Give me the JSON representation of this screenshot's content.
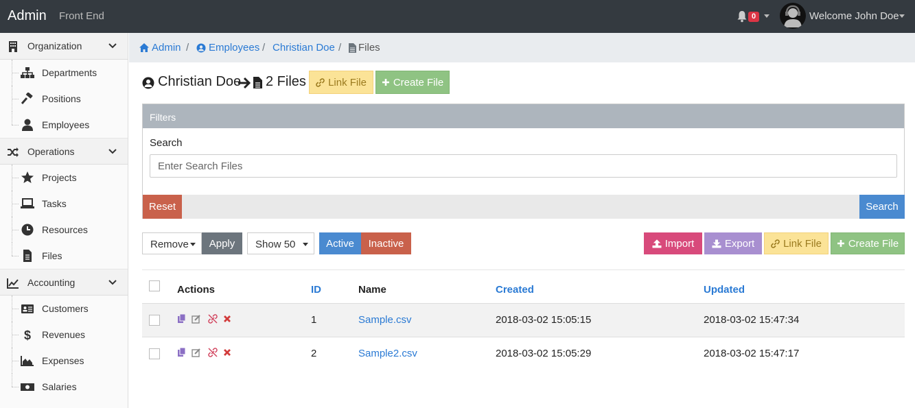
{
  "topbar": {
    "brand": "Admin",
    "front_end": "Front End",
    "notification_count": "0",
    "welcome": "Welcome John Doe"
  },
  "sidebar": {
    "sections": [
      {
        "label": "Organization",
        "icon": "building-icon",
        "items": [
          {
            "label": "Departments",
            "icon": "sitemap-icon"
          },
          {
            "label": "Positions",
            "icon": "gavel-icon"
          },
          {
            "label": "Employees",
            "icon": "user-icon"
          }
        ]
      },
      {
        "label": "Operations",
        "icon": "random-icon",
        "items": [
          {
            "label": "Projects",
            "icon": "star-icon"
          },
          {
            "label": "Tasks",
            "icon": "laptop-icon"
          },
          {
            "label": "Resources",
            "icon": "clock-icon"
          },
          {
            "label": "Files",
            "icon": "file-icon"
          }
        ]
      },
      {
        "label": "Accounting",
        "icon": "line-chart-icon",
        "items": [
          {
            "label": "Customers",
            "icon": "address-card-icon"
          },
          {
            "label": "Revenues",
            "icon": "dollar-icon"
          },
          {
            "label": "Expenses",
            "icon": "area-chart-icon"
          },
          {
            "label": "Salaries",
            "icon": "money-icon"
          }
        ]
      }
    ]
  },
  "breadcrumb": {
    "admin": "Admin",
    "employees": "Employees",
    "person": "Christian Doe",
    "current": "Files",
    "separator": "/"
  },
  "heading": {
    "person": "Christian Doe",
    "files": "2 Files",
    "link_file": "Link File",
    "create_file": "Create File"
  },
  "filters": {
    "title": "Filters",
    "search_label": "Search",
    "search_placeholder": "Enter Search Files",
    "search_value": "",
    "reset": "Reset",
    "search_button": "Search"
  },
  "toolbar": {
    "bulk_action": "Remove",
    "apply": "Apply",
    "show": "Show 50",
    "active": "Active",
    "inactive": "Inactive",
    "import": "Import",
    "export": "Export",
    "link_file": "Link File",
    "create_file": "Create File"
  },
  "table": {
    "columns": {
      "actions": "Actions",
      "id": "ID",
      "name": "Name",
      "created": "Created",
      "updated": "Updated"
    },
    "rows": [
      {
        "id": "1",
        "name": "Sample.csv",
        "created": "2018-03-02 15:05:15",
        "updated": "2018-03-02 15:47:34"
      },
      {
        "id": "2",
        "name": "Sample2.csv",
        "created": "2018-03-02 15:05:29",
        "updated": "2018-03-02 15:47:17"
      }
    ]
  },
  "colors": {
    "topbar": "#343a40",
    "link": "#2a7ad4",
    "danger": "#c9614b",
    "primary": "#4a8ad0",
    "success": "#8fc383",
    "warning": "#fbe397"
  }
}
